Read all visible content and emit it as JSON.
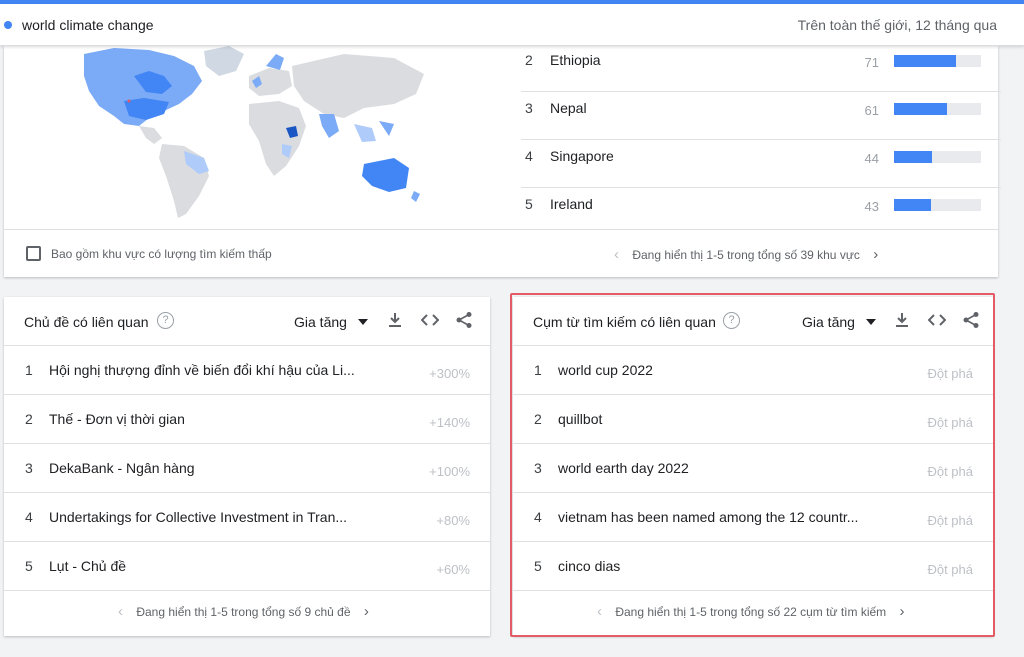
{
  "search": {
    "term": "world climate change",
    "scope": "Trên toàn thế giới, 12 tháng qua"
  },
  "colors": {
    "accent": "#4285f4",
    "highlight_border": "#e35b65"
  },
  "regions": {
    "rows": [
      {
        "rank": "2",
        "name": "Ethiopia",
        "value": "71",
        "score": 71
      },
      {
        "rank": "3",
        "name": "Nepal",
        "value": "61",
        "score": 61
      },
      {
        "rank": "4",
        "name": "Singapore",
        "value": "44",
        "score": 44
      },
      {
        "rank": "5",
        "name": "Ireland",
        "value": "43",
        "score": 43
      }
    ],
    "low_volume_label": "Bao gồm khu vực có lượng tìm kiếm thấp",
    "pager_text": "Đang hiển thị 1-5 trong tổng số 39 khu vực"
  },
  "related_topics": {
    "title": "Chủ đề có liên quan",
    "sort": "Gia tăng",
    "items": [
      {
        "rank": "1",
        "label": "Hội nghị thượng đỉnh về biến đổi khí hậu của Li...",
        "value": "+300%"
      },
      {
        "rank": "2",
        "label": "Thế - Đơn vị thời gian",
        "value": "+140%"
      },
      {
        "rank": "3",
        "label": "DekaBank - Ngân hàng",
        "value": "+100%"
      },
      {
        "rank": "4",
        "label": "Undertakings for Collective Investment in Tran...",
        "value": "+80%"
      },
      {
        "rank": "5",
        "label": "Lụt - Chủ đề",
        "value": "+60%"
      }
    ],
    "pager_text": "Đang hiển thị 1-5 trong tổng số 9 chủ đề"
  },
  "related_queries": {
    "title": "Cụm từ tìm kiếm có liên quan",
    "sort": "Gia tăng",
    "items": [
      {
        "rank": "1",
        "label": "world cup 2022",
        "value": "Đột phá"
      },
      {
        "rank": "2",
        "label": "quillbot",
        "value": "Đột phá"
      },
      {
        "rank": "3",
        "label": "world earth day 2022",
        "value": "Đột phá"
      },
      {
        "rank": "4",
        "label": "vietnam has been named among the 12 countr...",
        "value": "Đột phá"
      },
      {
        "rank": "5",
        "label": "cinco dias",
        "value": "Đột phá"
      }
    ],
    "pager_text": "Đang hiển thị 1-5 trong tổng số 22 cụm từ tìm kiếm"
  }
}
